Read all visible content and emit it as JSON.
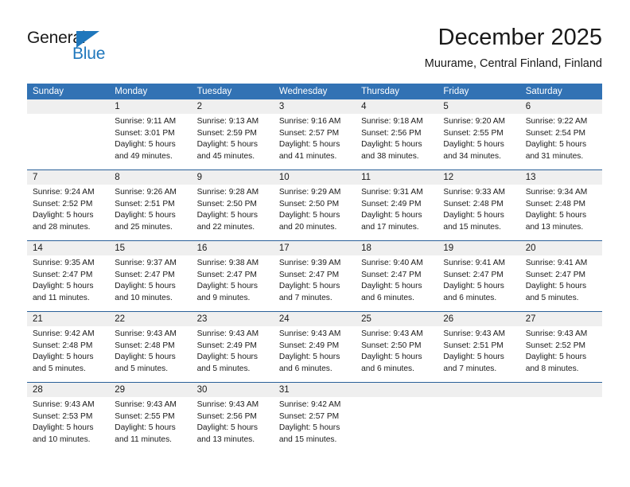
{
  "brand": {
    "logo_text_top": "General",
    "logo_text_bottom": "Blue",
    "logo_accent_color": "#1f77bc",
    "triangle_icon": "triangle-icon"
  },
  "header": {
    "title": "December 2025",
    "location": "Muurame, Central Finland, Finland"
  },
  "calendar": {
    "header_bg": "#3272b4",
    "row_divider_color": "#2a6099",
    "daynum_bg": "#efefef",
    "weekday_headers": [
      "Sunday",
      "Monday",
      "Tuesday",
      "Wednesday",
      "Thursday",
      "Friday",
      "Saturday"
    ],
    "weeks": [
      [
        {
          "day": "",
          "sunrise": "",
          "sunset": "",
          "daylight_line1": "",
          "daylight_line2": ""
        },
        {
          "day": "1",
          "sunrise": "Sunrise: 9:11 AM",
          "sunset": "Sunset: 3:01 PM",
          "daylight_line1": "Daylight: 5 hours",
          "daylight_line2": "and 49 minutes."
        },
        {
          "day": "2",
          "sunrise": "Sunrise: 9:13 AM",
          "sunset": "Sunset: 2:59 PM",
          "daylight_line1": "Daylight: 5 hours",
          "daylight_line2": "and 45 minutes."
        },
        {
          "day": "3",
          "sunrise": "Sunrise: 9:16 AM",
          "sunset": "Sunset: 2:57 PM",
          "daylight_line1": "Daylight: 5 hours",
          "daylight_line2": "and 41 minutes."
        },
        {
          "day": "4",
          "sunrise": "Sunrise: 9:18 AM",
          "sunset": "Sunset: 2:56 PM",
          "daylight_line1": "Daylight: 5 hours",
          "daylight_line2": "and 38 minutes."
        },
        {
          "day": "5",
          "sunrise": "Sunrise: 9:20 AM",
          "sunset": "Sunset: 2:55 PM",
          "daylight_line1": "Daylight: 5 hours",
          "daylight_line2": "and 34 minutes."
        },
        {
          "day": "6",
          "sunrise": "Sunrise: 9:22 AM",
          "sunset": "Sunset: 2:54 PM",
          "daylight_line1": "Daylight: 5 hours",
          "daylight_line2": "and 31 minutes."
        }
      ],
      [
        {
          "day": "7",
          "sunrise": "Sunrise: 9:24 AM",
          "sunset": "Sunset: 2:52 PM",
          "daylight_line1": "Daylight: 5 hours",
          "daylight_line2": "and 28 minutes."
        },
        {
          "day": "8",
          "sunrise": "Sunrise: 9:26 AM",
          "sunset": "Sunset: 2:51 PM",
          "daylight_line1": "Daylight: 5 hours",
          "daylight_line2": "and 25 minutes."
        },
        {
          "day": "9",
          "sunrise": "Sunrise: 9:28 AM",
          "sunset": "Sunset: 2:50 PM",
          "daylight_line1": "Daylight: 5 hours",
          "daylight_line2": "and 22 minutes."
        },
        {
          "day": "10",
          "sunrise": "Sunrise: 9:29 AM",
          "sunset": "Sunset: 2:50 PM",
          "daylight_line1": "Daylight: 5 hours",
          "daylight_line2": "and 20 minutes."
        },
        {
          "day": "11",
          "sunrise": "Sunrise: 9:31 AM",
          "sunset": "Sunset: 2:49 PM",
          "daylight_line1": "Daylight: 5 hours",
          "daylight_line2": "and 17 minutes."
        },
        {
          "day": "12",
          "sunrise": "Sunrise: 9:33 AM",
          "sunset": "Sunset: 2:48 PM",
          "daylight_line1": "Daylight: 5 hours",
          "daylight_line2": "and 15 minutes."
        },
        {
          "day": "13",
          "sunrise": "Sunrise: 9:34 AM",
          "sunset": "Sunset: 2:48 PM",
          "daylight_line1": "Daylight: 5 hours",
          "daylight_line2": "and 13 minutes."
        }
      ],
      [
        {
          "day": "14",
          "sunrise": "Sunrise: 9:35 AM",
          "sunset": "Sunset: 2:47 PM",
          "daylight_line1": "Daylight: 5 hours",
          "daylight_line2": "and 11 minutes."
        },
        {
          "day": "15",
          "sunrise": "Sunrise: 9:37 AM",
          "sunset": "Sunset: 2:47 PM",
          "daylight_line1": "Daylight: 5 hours",
          "daylight_line2": "and 10 minutes."
        },
        {
          "day": "16",
          "sunrise": "Sunrise: 9:38 AM",
          "sunset": "Sunset: 2:47 PM",
          "daylight_line1": "Daylight: 5 hours",
          "daylight_line2": "and 9 minutes."
        },
        {
          "day": "17",
          "sunrise": "Sunrise: 9:39 AM",
          "sunset": "Sunset: 2:47 PM",
          "daylight_line1": "Daylight: 5 hours",
          "daylight_line2": "and 7 minutes."
        },
        {
          "day": "18",
          "sunrise": "Sunrise: 9:40 AM",
          "sunset": "Sunset: 2:47 PM",
          "daylight_line1": "Daylight: 5 hours",
          "daylight_line2": "and 6 minutes."
        },
        {
          "day": "19",
          "sunrise": "Sunrise: 9:41 AM",
          "sunset": "Sunset: 2:47 PM",
          "daylight_line1": "Daylight: 5 hours",
          "daylight_line2": "and 6 minutes."
        },
        {
          "day": "20",
          "sunrise": "Sunrise: 9:41 AM",
          "sunset": "Sunset: 2:47 PM",
          "daylight_line1": "Daylight: 5 hours",
          "daylight_line2": "and 5 minutes."
        }
      ],
      [
        {
          "day": "21",
          "sunrise": "Sunrise: 9:42 AM",
          "sunset": "Sunset: 2:48 PM",
          "daylight_line1": "Daylight: 5 hours",
          "daylight_line2": "and 5 minutes."
        },
        {
          "day": "22",
          "sunrise": "Sunrise: 9:43 AM",
          "sunset": "Sunset: 2:48 PM",
          "daylight_line1": "Daylight: 5 hours",
          "daylight_line2": "and 5 minutes."
        },
        {
          "day": "23",
          "sunrise": "Sunrise: 9:43 AM",
          "sunset": "Sunset: 2:49 PM",
          "daylight_line1": "Daylight: 5 hours",
          "daylight_line2": "and 5 minutes."
        },
        {
          "day": "24",
          "sunrise": "Sunrise: 9:43 AM",
          "sunset": "Sunset: 2:49 PM",
          "daylight_line1": "Daylight: 5 hours",
          "daylight_line2": "and 6 minutes."
        },
        {
          "day": "25",
          "sunrise": "Sunrise: 9:43 AM",
          "sunset": "Sunset: 2:50 PM",
          "daylight_line1": "Daylight: 5 hours",
          "daylight_line2": "and 6 minutes."
        },
        {
          "day": "26",
          "sunrise": "Sunrise: 9:43 AM",
          "sunset": "Sunset: 2:51 PM",
          "daylight_line1": "Daylight: 5 hours",
          "daylight_line2": "and 7 minutes."
        },
        {
          "day": "27",
          "sunrise": "Sunrise: 9:43 AM",
          "sunset": "Sunset: 2:52 PM",
          "daylight_line1": "Daylight: 5 hours",
          "daylight_line2": "and 8 minutes."
        }
      ],
      [
        {
          "day": "28",
          "sunrise": "Sunrise: 9:43 AM",
          "sunset": "Sunset: 2:53 PM",
          "daylight_line1": "Daylight: 5 hours",
          "daylight_line2": "and 10 minutes."
        },
        {
          "day": "29",
          "sunrise": "Sunrise: 9:43 AM",
          "sunset": "Sunset: 2:55 PM",
          "daylight_line1": "Daylight: 5 hours",
          "daylight_line2": "and 11 minutes."
        },
        {
          "day": "30",
          "sunrise": "Sunrise: 9:43 AM",
          "sunset": "Sunset: 2:56 PM",
          "daylight_line1": "Daylight: 5 hours",
          "daylight_line2": "and 13 minutes."
        },
        {
          "day": "31",
          "sunrise": "Sunrise: 9:42 AM",
          "sunset": "Sunset: 2:57 PM",
          "daylight_line1": "Daylight: 5 hours",
          "daylight_line2": "and 15 minutes."
        },
        {
          "day": "",
          "sunrise": "",
          "sunset": "",
          "daylight_line1": "",
          "daylight_line2": ""
        },
        {
          "day": "",
          "sunrise": "",
          "sunset": "",
          "daylight_line1": "",
          "daylight_line2": ""
        },
        {
          "day": "",
          "sunrise": "",
          "sunset": "",
          "daylight_line1": "",
          "daylight_line2": ""
        }
      ]
    ]
  }
}
